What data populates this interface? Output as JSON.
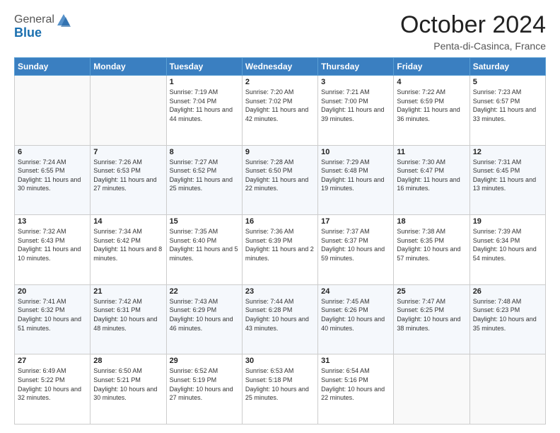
{
  "header": {
    "logo_general": "General",
    "logo_blue": "Blue",
    "month": "October 2024",
    "location": "Penta-di-Casinca, France"
  },
  "weekdays": [
    "Sunday",
    "Monday",
    "Tuesday",
    "Wednesday",
    "Thursday",
    "Friday",
    "Saturday"
  ],
  "weeks": [
    [
      null,
      null,
      {
        "day": 1,
        "sunrise": "7:19 AM",
        "sunset": "7:04 PM",
        "daylight": "11 hours and 44 minutes."
      },
      {
        "day": 2,
        "sunrise": "7:20 AM",
        "sunset": "7:02 PM",
        "daylight": "11 hours and 42 minutes."
      },
      {
        "day": 3,
        "sunrise": "7:21 AM",
        "sunset": "7:00 PM",
        "daylight": "11 hours and 39 minutes."
      },
      {
        "day": 4,
        "sunrise": "7:22 AM",
        "sunset": "6:59 PM",
        "daylight": "11 hours and 36 minutes."
      },
      {
        "day": 5,
        "sunrise": "7:23 AM",
        "sunset": "6:57 PM",
        "daylight": "11 hours and 33 minutes."
      }
    ],
    [
      {
        "day": 6,
        "sunrise": "7:24 AM",
        "sunset": "6:55 PM",
        "daylight": "11 hours and 30 minutes."
      },
      {
        "day": 7,
        "sunrise": "7:26 AM",
        "sunset": "6:53 PM",
        "daylight": "11 hours and 27 minutes."
      },
      {
        "day": 8,
        "sunrise": "7:27 AM",
        "sunset": "6:52 PM",
        "daylight": "11 hours and 25 minutes."
      },
      {
        "day": 9,
        "sunrise": "7:28 AM",
        "sunset": "6:50 PM",
        "daylight": "11 hours and 22 minutes."
      },
      {
        "day": 10,
        "sunrise": "7:29 AM",
        "sunset": "6:48 PM",
        "daylight": "11 hours and 19 minutes."
      },
      {
        "day": 11,
        "sunrise": "7:30 AM",
        "sunset": "6:47 PM",
        "daylight": "11 hours and 16 minutes."
      },
      {
        "day": 12,
        "sunrise": "7:31 AM",
        "sunset": "6:45 PM",
        "daylight": "11 hours and 13 minutes."
      }
    ],
    [
      {
        "day": 13,
        "sunrise": "7:32 AM",
        "sunset": "6:43 PM",
        "daylight": "11 hours and 10 minutes."
      },
      {
        "day": 14,
        "sunrise": "7:34 AM",
        "sunset": "6:42 PM",
        "daylight": "11 hours and 8 minutes."
      },
      {
        "day": 15,
        "sunrise": "7:35 AM",
        "sunset": "6:40 PM",
        "daylight": "11 hours and 5 minutes."
      },
      {
        "day": 16,
        "sunrise": "7:36 AM",
        "sunset": "6:39 PM",
        "daylight": "11 hours and 2 minutes."
      },
      {
        "day": 17,
        "sunrise": "7:37 AM",
        "sunset": "6:37 PM",
        "daylight": "10 hours and 59 minutes."
      },
      {
        "day": 18,
        "sunrise": "7:38 AM",
        "sunset": "6:35 PM",
        "daylight": "10 hours and 57 minutes."
      },
      {
        "day": 19,
        "sunrise": "7:39 AM",
        "sunset": "6:34 PM",
        "daylight": "10 hours and 54 minutes."
      }
    ],
    [
      {
        "day": 20,
        "sunrise": "7:41 AM",
        "sunset": "6:32 PM",
        "daylight": "10 hours and 51 minutes."
      },
      {
        "day": 21,
        "sunrise": "7:42 AM",
        "sunset": "6:31 PM",
        "daylight": "10 hours and 48 minutes."
      },
      {
        "day": 22,
        "sunrise": "7:43 AM",
        "sunset": "6:29 PM",
        "daylight": "10 hours and 46 minutes."
      },
      {
        "day": 23,
        "sunrise": "7:44 AM",
        "sunset": "6:28 PM",
        "daylight": "10 hours and 43 minutes."
      },
      {
        "day": 24,
        "sunrise": "7:45 AM",
        "sunset": "6:26 PM",
        "daylight": "10 hours and 40 minutes."
      },
      {
        "day": 25,
        "sunrise": "7:47 AM",
        "sunset": "6:25 PM",
        "daylight": "10 hours and 38 minutes."
      },
      {
        "day": 26,
        "sunrise": "7:48 AM",
        "sunset": "6:23 PM",
        "daylight": "10 hours and 35 minutes."
      }
    ],
    [
      {
        "day": 27,
        "sunrise": "6:49 AM",
        "sunset": "5:22 PM",
        "daylight": "10 hours and 32 minutes."
      },
      {
        "day": 28,
        "sunrise": "6:50 AM",
        "sunset": "5:21 PM",
        "daylight": "10 hours and 30 minutes."
      },
      {
        "day": 29,
        "sunrise": "6:52 AM",
        "sunset": "5:19 PM",
        "daylight": "10 hours and 27 minutes."
      },
      {
        "day": 30,
        "sunrise": "6:53 AM",
        "sunset": "5:18 PM",
        "daylight": "10 hours and 25 minutes."
      },
      {
        "day": 31,
        "sunrise": "6:54 AM",
        "sunset": "5:16 PM",
        "daylight": "10 hours and 22 minutes."
      },
      null,
      null
    ]
  ]
}
